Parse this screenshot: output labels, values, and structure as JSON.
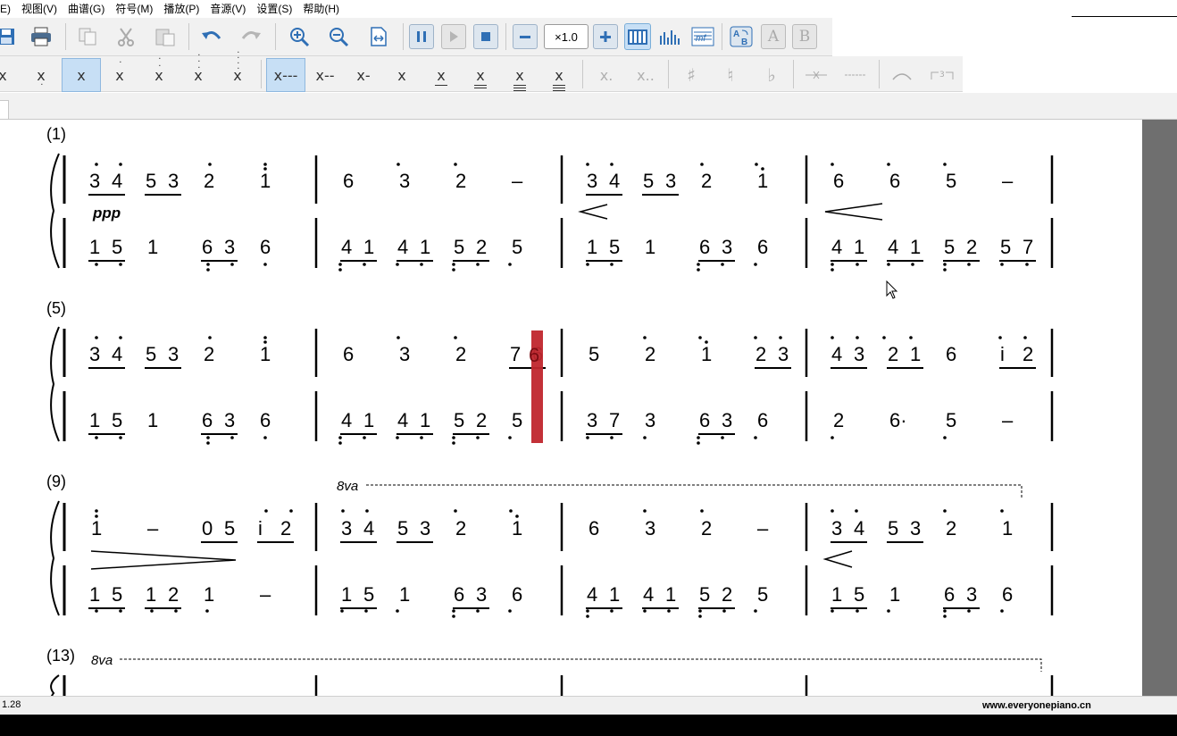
{
  "menu": [
    "E)",
    "视图(V)",
    "曲谱(G)",
    "符号(M)",
    "播放(P)",
    "音源(V)",
    "设置(S)",
    "帮助(H)"
  ],
  "toolbar": {
    "zoom": "×1.0",
    "buttons": [
      "save-icon",
      "print-icon",
      "copy-icon",
      "cut-icon",
      "paste-icon",
      "undo-icon",
      "redo-icon",
      "zoom-in-icon",
      "zoom-out-icon",
      "fit-page-icon",
      "pause-icon",
      "play-icon",
      "stop-icon",
      "minus-icon",
      "plus-icon",
      "keyboard-icon",
      "equalizer-icon",
      "staff-icon",
      "convert-icon",
      "letter-a-icon",
      "letter-b-icon"
    ]
  },
  "notebar": {
    "durations": [
      "x",
      "x",
      "x",
      "x",
      "x",
      "x",
      "x"
    ],
    "lengths": [
      "x---",
      "x--",
      "x-",
      "x",
      "x",
      "x",
      "x",
      "x"
    ],
    "dots": [
      "x.",
      "x.."
    ],
    "accidentals": [
      "♯",
      "♮",
      "♭"
    ]
  },
  "score": {
    "systems": [
      {
        "number": "(1)",
        "dynamic": "ppp",
        "octave": "",
        "treble": [
          [
            "3 4",
            "5 3",
            "2",
            "i"
          ],
          [
            "6",
            "3",
            "2",
            "–"
          ],
          [
            "3 4",
            "5 3",
            "2",
            "i"
          ],
          [
            "6",
            "6",
            "5",
            "–"
          ]
        ],
        "bass": [
          [
            "1 5",
            "1",
            "6 3",
            "6"
          ],
          [
            "4 1",
            "4 1",
            "5 2",
            "5"
          ],
          [
            "1 5",
            "1",
            "6 3",
            "6"
          ],
          [
            "4 1",
            "4 1",
            "5 2",
            "5 7"
          ]
        ]
      },
      {
        "number": "(5)",
        "dynamic": "",
        "octave": "",
        "treble": [
          [
            "3 4",
            "5 3",
            "2",
            "i"
          ],
          [
            "6",
            "3",
            "2",
            "7 6"
          ],
          [
            "5",
            "2",
            "i",
            "2 3"
          ],
          [
            "4 3",
            "2 1",
            "6",
            "i 2"
          ]
        ],
        "bass": [
          [
            "1 5",
            "1",
            "6 3",
            "6"
          ],
          [
            "4 1",
            "4 1",
            "5 2",
            "5"
          ],
          [
            "3 7",
            "3",
            "6 3",
            "6"
          ],
          [
            "2",
            "6·",
            "5",
            "–"
          ]
        ]
      },
      {
        "number": "(9)",
        "dynamic": "",
        "octave": "8va",
        "treble": [
          [
            "i",
            "–",
            "0 5",
            "i 2"
          ],
          [
            "3 4",
            "5 3",
            "2",
            "i"
          ],
          [
            "6",
            "3",
            "2",
            "–"
          ],
          [
            "3 4",
            "5 3",
            "2",
            "1"
          ]
        ],
        "bass": [
          [
            "1 5",
            "1 2",
            "1",
            "–"
          ],
          [
            "1 5",
            "1",
            "6 3",
            "6"
          ],
          [
            "4 1",
            "4 1",
            "5 2",
            "5"
          ],
          [
            "1 5",
            "1",
            "6 3",
            "6"
          ]
        ]
      },
      {
        "number": "(13)",
        "dynamic": "",
        "octave": "8va",
        "treble": [],
        "bass": []
      }
    ]
  },
  "status": {
    "left": "1.28",
    "right": "www.everyonepiano.cn"
  },
  "colors": {
    "cursor_bar": "#c0262d",
    "toolbar_bg": "#f1f1f1",
    "selected_bg": "#c7dff5",
    "scrollbar": "#6f6f6f"
  }
}
